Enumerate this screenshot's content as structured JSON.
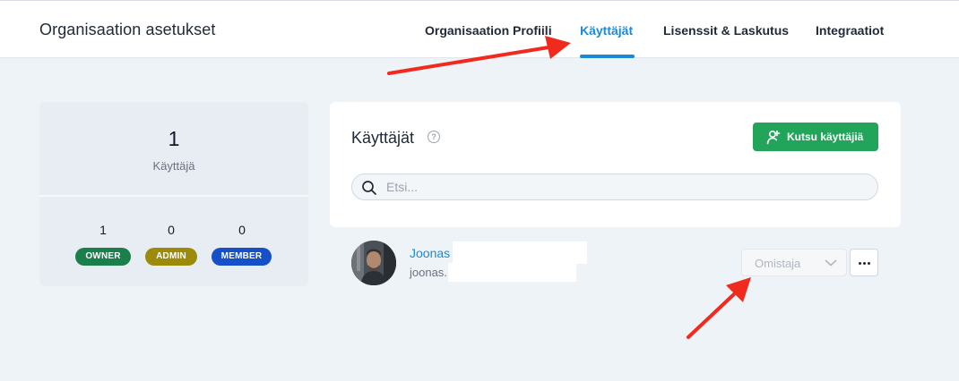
{
  "header": {
    "title": "Organisaation asetukset",
    "tabs": [
      {
        "label": "Organisaation Profiili",
        "active": false
      },
      {
        "label": "Käyttäjät",
        "active": true
      },
      {
        "label": "Lisenssit & Laskutus",
        "active": false
      },
      {
        "label": "Integraatiot",
        "active": false
      }
    ]
  },
  "stats": {
    "total": "1",
    "total_label": "Käyttäjä",
    "roles": [
      {
        "count": "1",
        "badge": "OWNER",
        "color": "#1a7f4b"
      },
      {
        "count": "0",
        "badge": "ADMIN",
        "color": "#9c8a0a"
      },
      {
        "count": "0",
        "badge": "MEMBER",
        "color": "#1650c8"
      }
    ]
  },
  "users_panel": {
    "title": "Käyttäjät",
    "help_icon": "question-circle-icon",
    "invite_button": "Kutsu käyttäjiä",
    "search_placeholder": "Etsi..."
  },
  "user": {
    "name": "Joonas",
    "email": "joonas.",
    "role": "Omistaja"
  },
  "colors": {
    "accent": "#1a8ad8",
    "invite_green": "#22a55a",
    "annotation_arrow": "#f02b1d"
  }
}
